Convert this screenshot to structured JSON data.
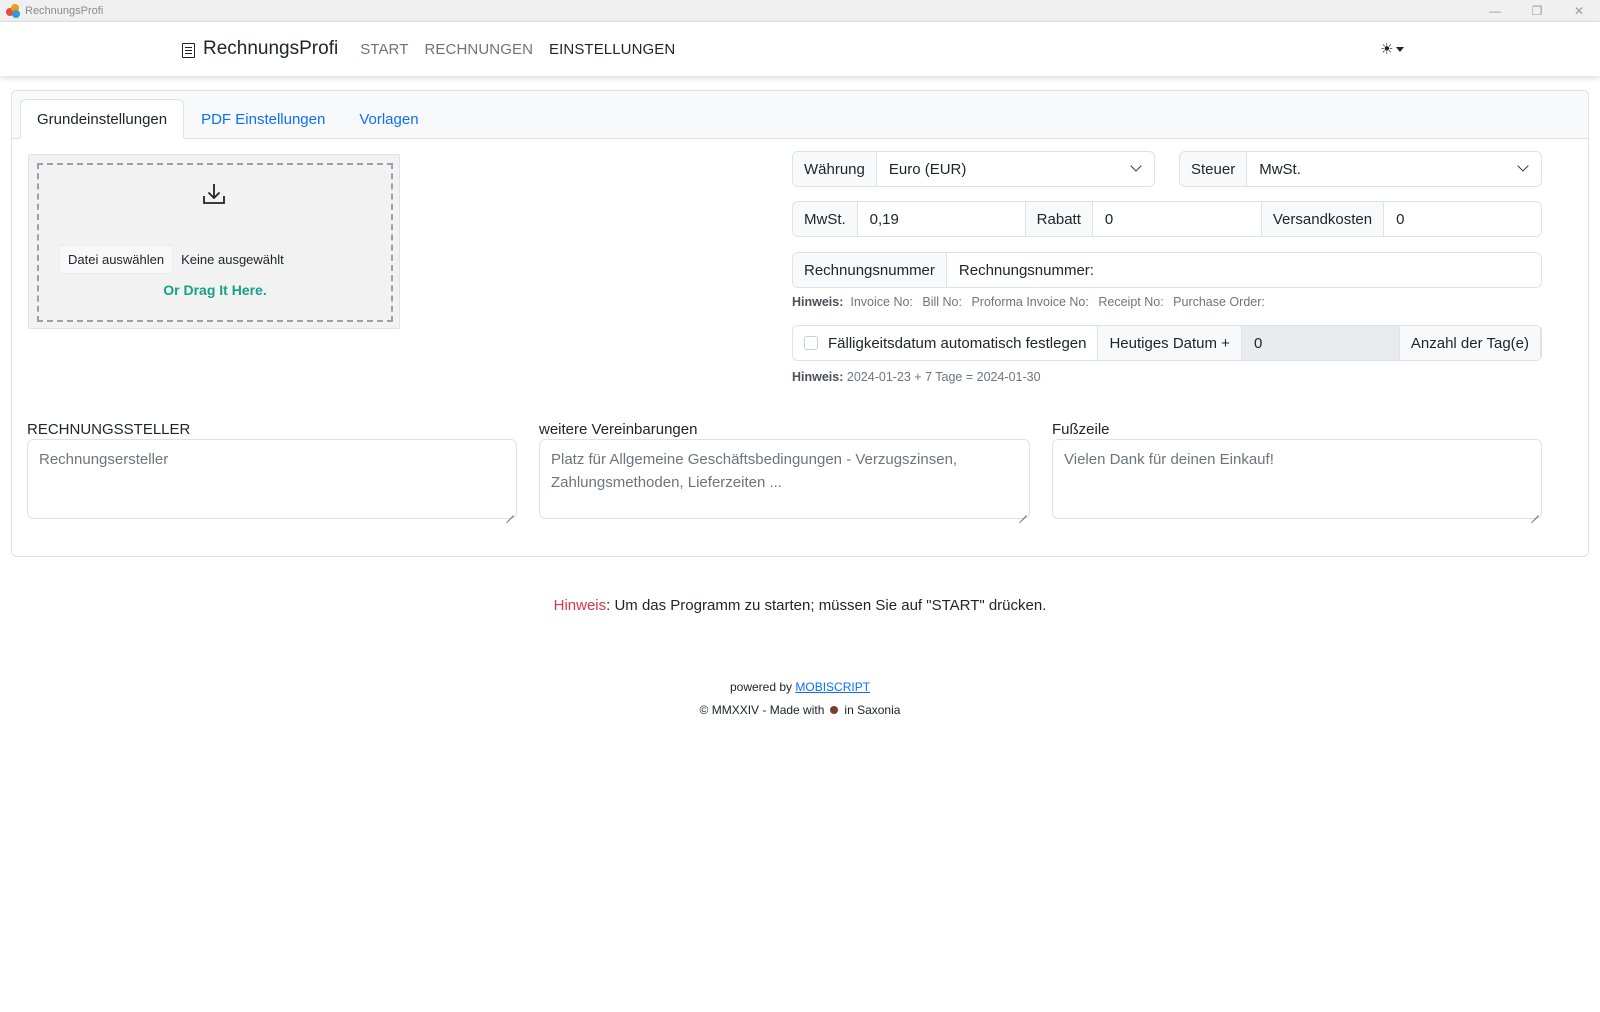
{
  "window": {
    "title": "RechnungsProfi",
    "controls": {
      "minimize": "—",
      "restore": "❐",
      "close": "✕"
    }
  },
  "navbar": {
    "brand": "RechnungsProfi",
    "brand_icon": "receipt-icon",
    "links": [
      "START",
      "RECHNUNGEN",
      "EINSTELLUNGEN"
    ],
    "active": "EINSTELLUNGEN",
    "theme_icon": "☀"
  },
  "tabs": [
    "Grundeinstellungen",
    "PDF Einstellungen",
    "Vorlagen"
  ],
  "upload": {
    "icon": "download-icon",
    "button": "Datei auswählen",
    "status": "Keine ausgewählt",
    "drag_text": "Or Drag It Here."
  },
  "currency": {
    "label": "Währung",
    "value": "Euro (EUR)"
  },
  "tax": {
    "label": "Steuer",
    "value": "MwSt."
  },
  "rates": {
    "mwst_label": "MwSt.",
    "mwst_value": "0,19",
    "rabatt_label": "Rabatt",
    "rabatt_value": "0",
    "versand_label": "Versandkosten",
    "versand_value": "0"
  },
  "invoice_number": {
    "label": "Rechnungsnummer",
    "value": "Rechnungsnummer:"
  },
  "invoice_hint": {
    "label": "Hinweis:",
    "items": [
      "Invoice No:",
      "Bill No:",
      "Proforma Invoice No:",
      "Receipt No:",
      "Purchase Order:"
    ]
  },
  "due_date": {
    "checkbox_label": "Fälligkeitsdatum automatisch festlegen",
    "checked": false,
    "today_label": "Heutiges Datum +",
    "days_value": "0",
    "days_label": "Anzahl der Tag(e)"
  },
  "due_hint": {
    "label": "Hinweis:",
    "text": "2024-01-23 + 7 Tage = 2024-01-30"
  },
  "issuer": {
    "label": "RECHNUNGSSTELLER",
    "placeholder": "Rechnungsersteller"
  },
  "agreements": {
    "label": "weitere Vereinbarungen",
    "placeholder_line1": "Platz für Allgemeine Geschäftsbedingungen - Verzugszinsen,",
    "placeholder_line2": "Zahlungsmethoden, Lieferzeiten ..."
  },
  "footer_field": {
    "label": "Fußzeile",
    "placeholder": "Vielen Dank für deinen Einkauf!"
  },
  "notice": {
    "label": "Hinweis",
    "text": ": Um das Programm zu starten; müssen Sie auf \"START\" drücken."
  },
  "credits": {
    "powered_prefix": "powered by",
    "powered_link": "MOBISCRIPT",
    "copy_prefix": "© MMXXIV - Made with",
    "copy_suffix": "in Saxonia"
  }
}
